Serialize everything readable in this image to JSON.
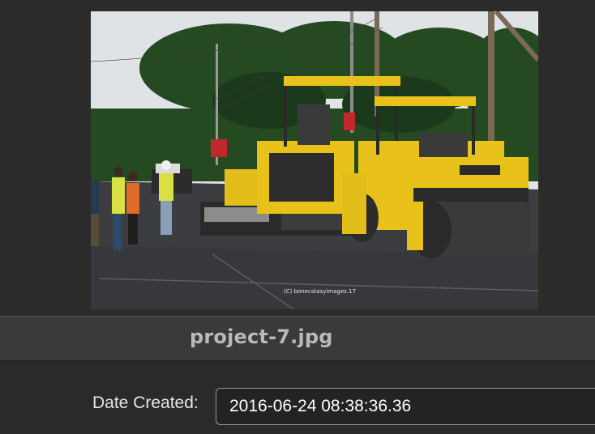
{
  "preview": {
    "image_alt": "Road construction: yellow asphalt paver and road roller with workers in high-visibility vests",
    "watermark": "(C) bonecstasyimages.17"
  },
  "file": {
    "name": "project-7.jpg"
  },
  "metadata": {
    "date_created_label": "Date Created:",
    "date_created_value": "2016-06-24 08:38:36.36"
  },
  "colors": {
    "background": "#2a2a2a",
    "filename_bar": "#3a3a3a",
    "filename_text": "#b9b9b9",
    "field_border": "#9a9a9a",
    "machine_yellow": "#e8c21a"
  }
}
